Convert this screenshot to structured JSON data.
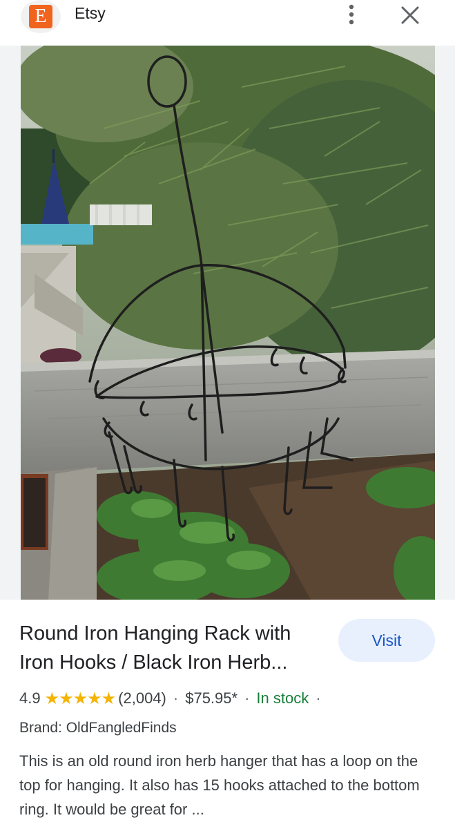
{
  "header": {
    "logo_letter": "E",
    "site_name": "Etsy",
    "menu_icon": "more-vert-icon",
    "close_icon": "close-icon"
  },
  "product": {
    "title": "Round Iron Hanging Rack with Iron Hooks / Black Iron Herb...",
    "visit_label": "Visit",
    "rating": "4.9",
    "stars": "★★★★★",
    "review_count": "(2,004)",
    "price": "$75.95*",
    "stock": "In stock",
    "brand": "Brand: OldFangledFinds",
    "description": "This is an old round iron herb hanger that has a loop on the top for hanging. It also has 15 hooks attached to the bottom ring. It would be great for ..."
  },
  "colors": {
    "brand_orange": "#f1641e",
    "visit_bg": "#e8f0fe",
    "visit_text": "#1a56c4",
    "stock_green": "#188038",
    "star_yellow": "#f4b400"
  }
}
